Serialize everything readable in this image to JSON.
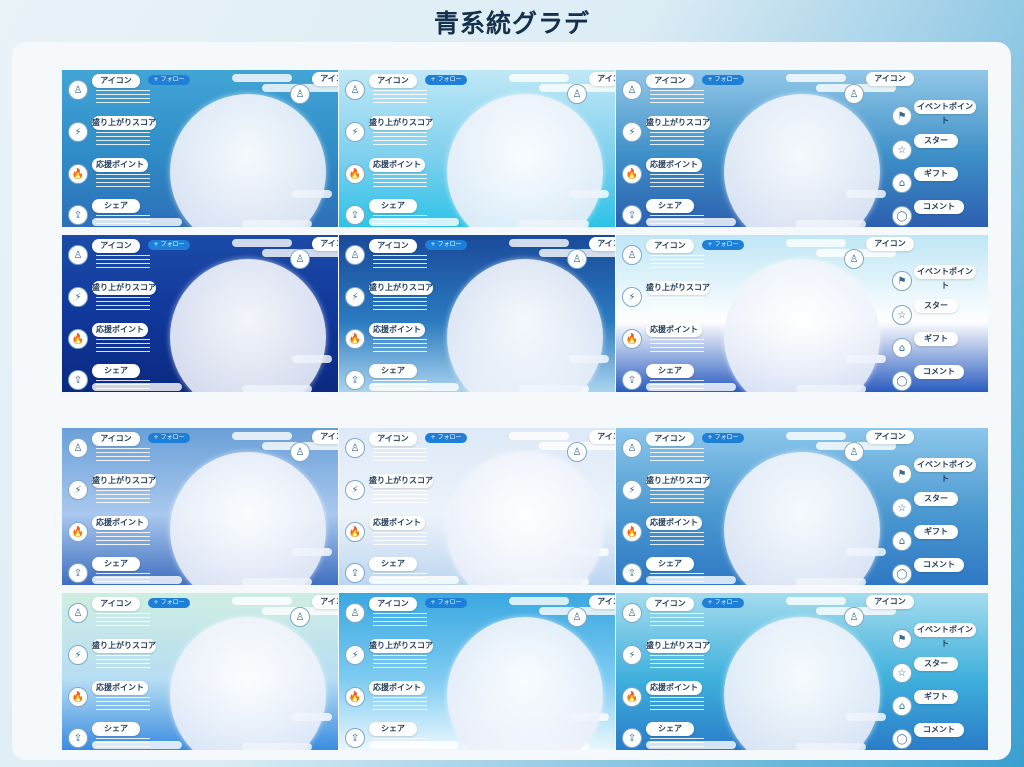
{
  "title": "青系統グラデ",
  "labels": {
    "icon": "アイコン",
    "follow": "+ フォロー",
    "moriagari": "盛り上がりスコア",
    "ouen": "応援ポイント",
    "share": "シェア",
    "event": "イベントポイント",
    "star": "スター",
    "gift": "ギフト",
    "comment": "コメント"
  },
  "rows": [
    [
      "#43a5d6,#2f8bc6,#2e6fb8",
      "#bfe8f6,#7fd0ee,#2cc3e8",
      "#93c8e8,#3d8fc7,#2d5fb0"
    ],
    [
      "#1c4ba8,#10369a,#0a2a80",
      "#1a4a9a,#2b7ac0,#aad4ee",
      "#bfe6f5,#ffffff,#2a5cc0"
    ],
    [
      "#6aa0d8,#a9c8ee,#3f6fc0",
      "#dde9f7,#edf3fb,#bcd6f0",
      "#8cc7ec,#4a98d0,#2f78c4"
    ],
    [
      "#cfeee2,#b6ddf3,#3a8ce0",
      "#3aa8e0,#7fcbf2,#eaf7fd",
      "#a4dcee,#3fb0dc,#2a7cc8"
    ]
  ]
}
